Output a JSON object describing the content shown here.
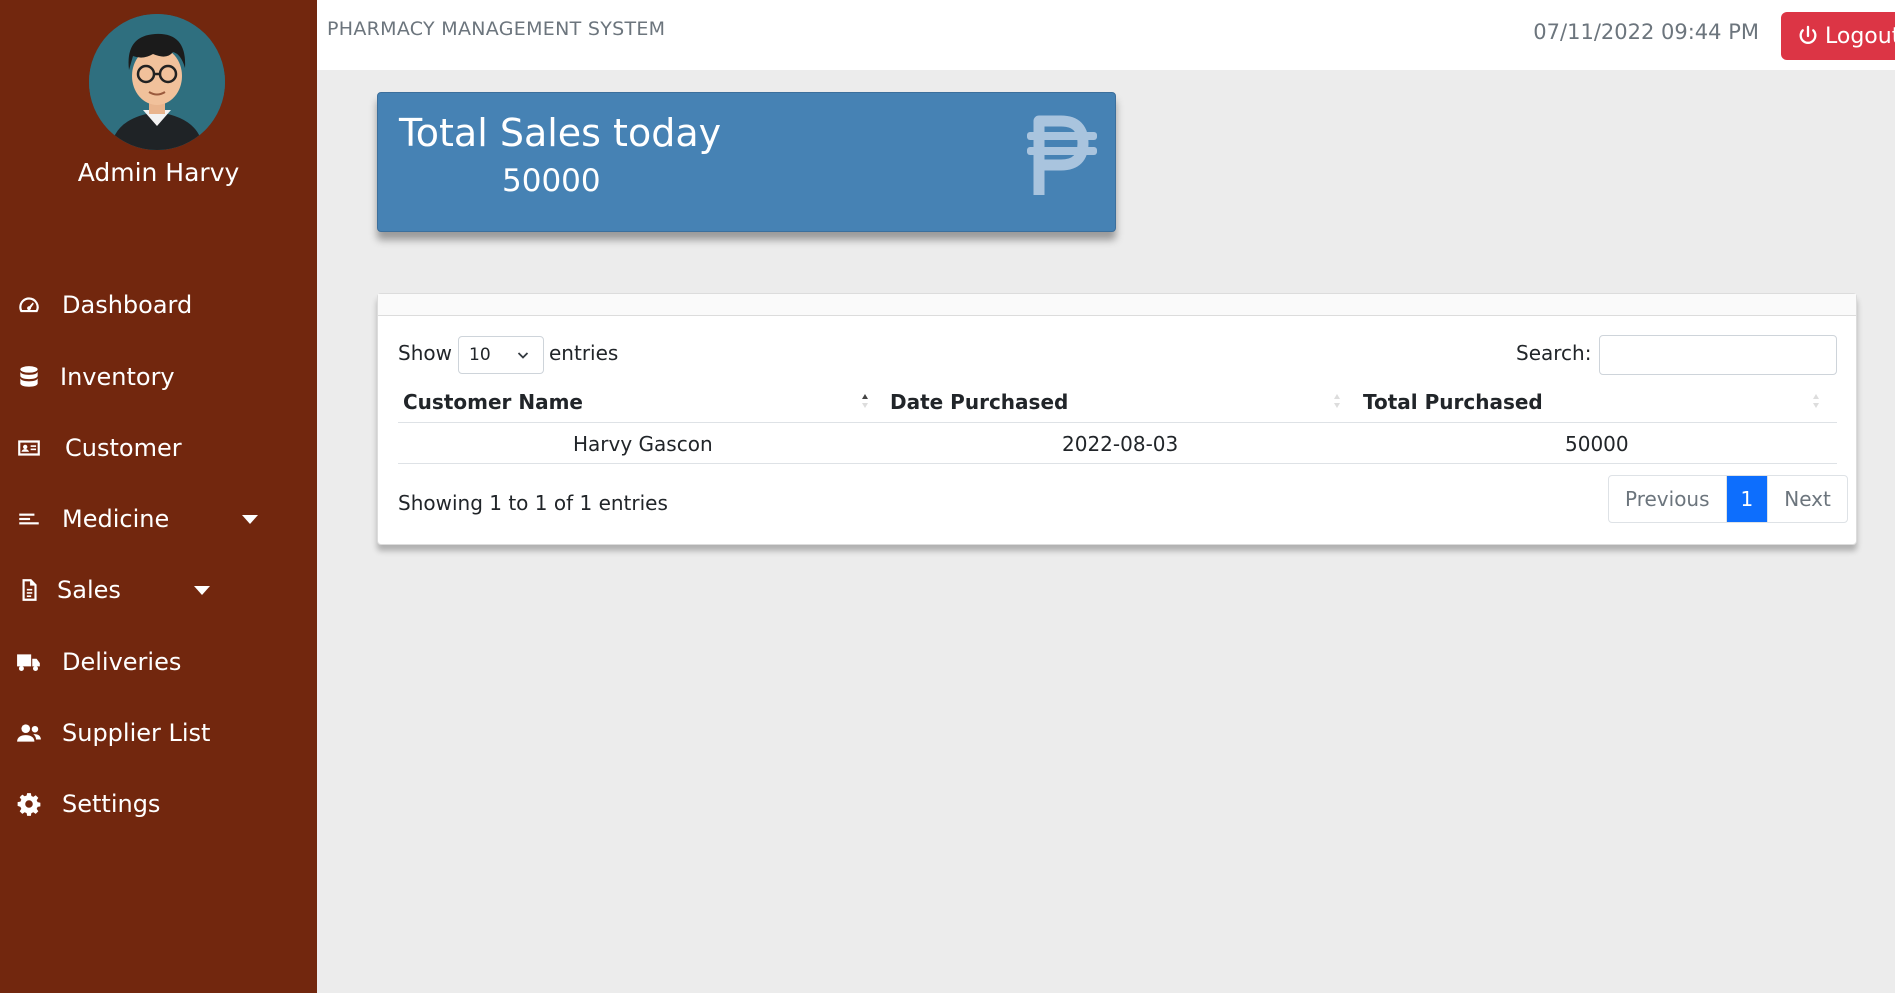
{
  "sidebar": {
    "user_name": "Admin Harvy",
    "items": [
      {
        "label": "Dashboard",
        "icon": "gauge-icon"
      },
      {
        "label": "Inventory",
        "icon": "database-icon"
      },
      {
        "label": "Customer",
        "icon": "id-card-icon"
      },
      {
        "label": "Medicine",
        "icon": "list-icon",
        "has_dropdown": true
      },
      {
        "label": "Sales",
        "icon": "document-icon",
        "has_dropdown": true
      },
      {
        "label": "Deliveries",
        "icon": "truck-icon"
      },
      {
        "label": "Supplier List",
        "icon": "users-icon"
      },
      {
        "label": "Settings",
        "icon": "gear-icon"
      }
    ],
    "background_color": "#72270e"
  },
  "topbar": {
    "system_title": "PHARMACY MANAGEMENT SYSTEM",
    "datetime": "07/11/2022 09:44 PM",
    "logout_label": "Logout",
    "logout_icon": "power-icon"
  },
  "sales_card": {
    "title": "Total Sales today",
    "value": "50000",
    "icon": "peso-icon",
    "color": "#4682b4"
  },
  "table": {
    "show_label": "Show",
    "page_size": "10",
    "entries_label": "entries",
    "search_label": "Search:",
    "search_value": "",
    "columns": [
      "Customer Name",
      "Date Purchased",
      "Total Purchased"
    ],
    "rows": [
      [
        "Harvy Gascon",
        "2022-08-03",
        "50000"
      ]
    ],
    "info": "Showing 1 to 1 of 1 entries",
    "pagination": {
      "previous": "Previous",
      "current": "1",
      "next": "Next"
    }
  },
  "colors": {
    "logout": "#dc3545",
    "active_page": "#0d6efd"
  }
}
